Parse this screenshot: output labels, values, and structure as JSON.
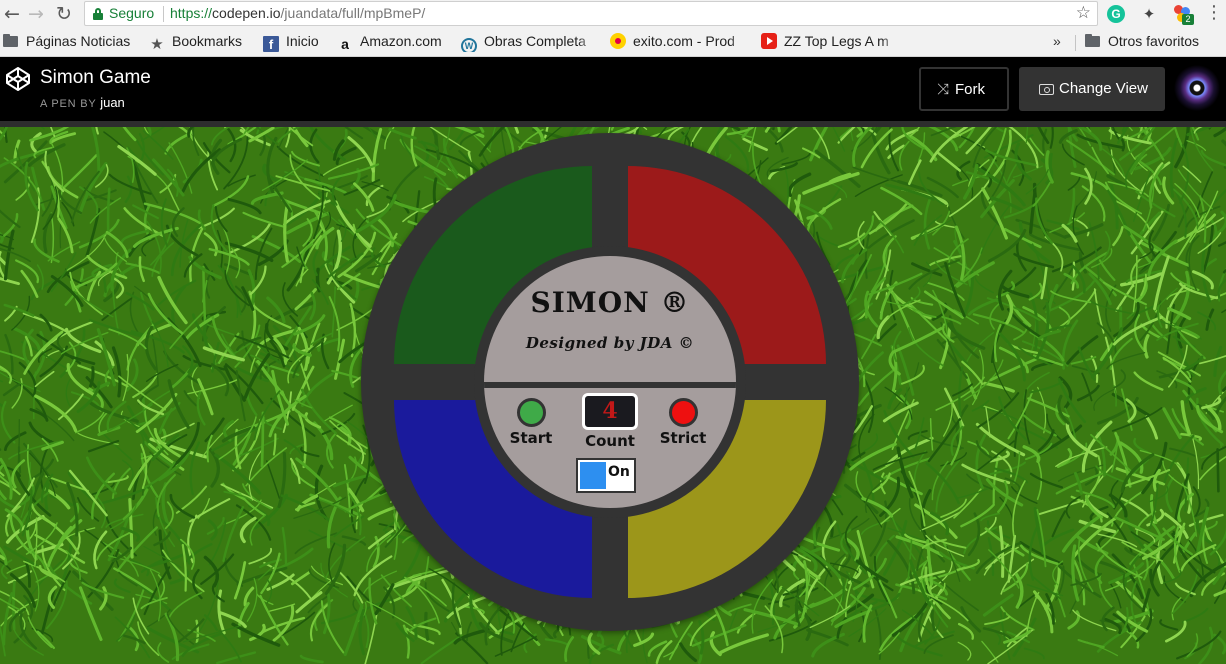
{
  "browser": {
    "back_icon": "arrow-left-icon",
    "forward_icon": "arrow-right-icon",
    "reload_icon": "reload-icon",
    "secure_label": "Seguro",
    "url_scheme": "https://",
    "url_host": "codepen.io",
    "url_path": "/juandata/full/mpBmeP/",
    "extension_badge": "2",
    "bookmarks": [
      {
        "label": "Páginas Noticias",
        "icon": "folder-icon"
      },
      {
        "label": "Bookmarks",
        "icon": "star-icon"
      },
      {
        "label": "Inicio",
        "icon": "facebook-icon"
      },
      {
        "label": "Amazon.com",
        "icon": "amazon-icon"
      },
      {
        "label": "Obras Completa",
        "icon": "wordpress-icon"
      },
      {
        "label": "exito.com - Prod",
        "icon": "exito-icon"
      },
      {
        "label": "ZZ Top Legs A m",
        "icon": "youtube-icon"
      }
    ],
    "overflow_label": "»",
    "other_bookmarks": "Otros favoritos"
  },
  "codepen": {
    "title": "Simon Game",
    "byline_prefix": "A PEN BY",
    "author": "juan",
    "fork_label": "Fork",
    "change_view_label": "Change View"
  },
  "simon": {
    "title": "SIMON ®",
    "credit": "Designed by JDA ©",
    "start_label": "Start",
    "count_label": "Count",
    "count_value": "4",
    "strict_label": "Strict",
    "power_label": "On",
    "colors": {
      "green": "#1a5a1c",
      "red": "#9c1a1a",
      "blue": "#1a1a9c",
      "yellow": "#9c961a",
      "housing": "#333333",
      "face": "#a59d9d"
    }
  }
}
